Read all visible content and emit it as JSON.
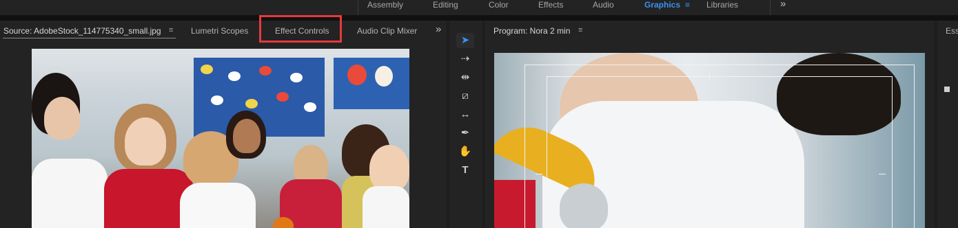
{
  "workspaces": {
    "tabs": [
      {
        "label": "Assembly",
        "active": false
      },
      {
        "label": "Editing",
        "active": false
      },
      {
        "label": "Color",
        "active": false
      },
      {
        "label": "Effects",
        "active": false
      },
      {
        "label": "Audio",
        "active": false
      },
      {
        "label": "Graphics",
        "active": true
      },
      {
        "label": "Libraries",
        "active": false
      }
    ],
    "menu_icon": "≡",
    "more_icon": "»"
  },
  "source_panel": {
    "tabs": [
      {
        "label": "Source: AdobeStock_114775340_small.jpg",
        "active": true
      },
      {
        "label": "Lumetri Scopes",
        "active": false
      },
      {
        "label": "Effect Controls",
        "active": false,
        "highlighted": true
      },
      {
        "label": "Audio Clip Mixer",
        "active": false
      }
    ],
    "menu_icon": "≡",
    "overflow_icon": "»"
  },
  "tools": [
    {
      "name": "selection-tool",
      "glyph": "➤",
      "active": true
    },
    {
      "name": "track-select-tool",
      "glyph": "⇢",
      "active": false
    },
    {
      "name": "ripple-edit-tool",
      "glyph": "⇹",
      "active": false
    },
    {
      "name": "razor-tool",
      "glyph": "⧄",
      "active": false
    },
    {
      "name": "slip-tool",
      "glyph": "↔",
      "active": false
    },
    {
      "name": "pen-tool",
      "glyph": "✒",
      "active": false
    },
    {
      "name": "hand-tool",
      "glyph": "✋",
      "active": false
    },
    {
      "name": "type-tool",
      "glyph": "T",
      "active": false
    }
  ],
  "program_panel": {
    "title": "Program: Nora 2 min",
    "menu_icon": "≡"
  },
  "essential_panel": {
    "label": "Esse"
  },
  "colors": {
    "accent": "#3b90f5",
    "highlight_box": "#e8393c",
    "panel_bg": "#232323"
  }
}
